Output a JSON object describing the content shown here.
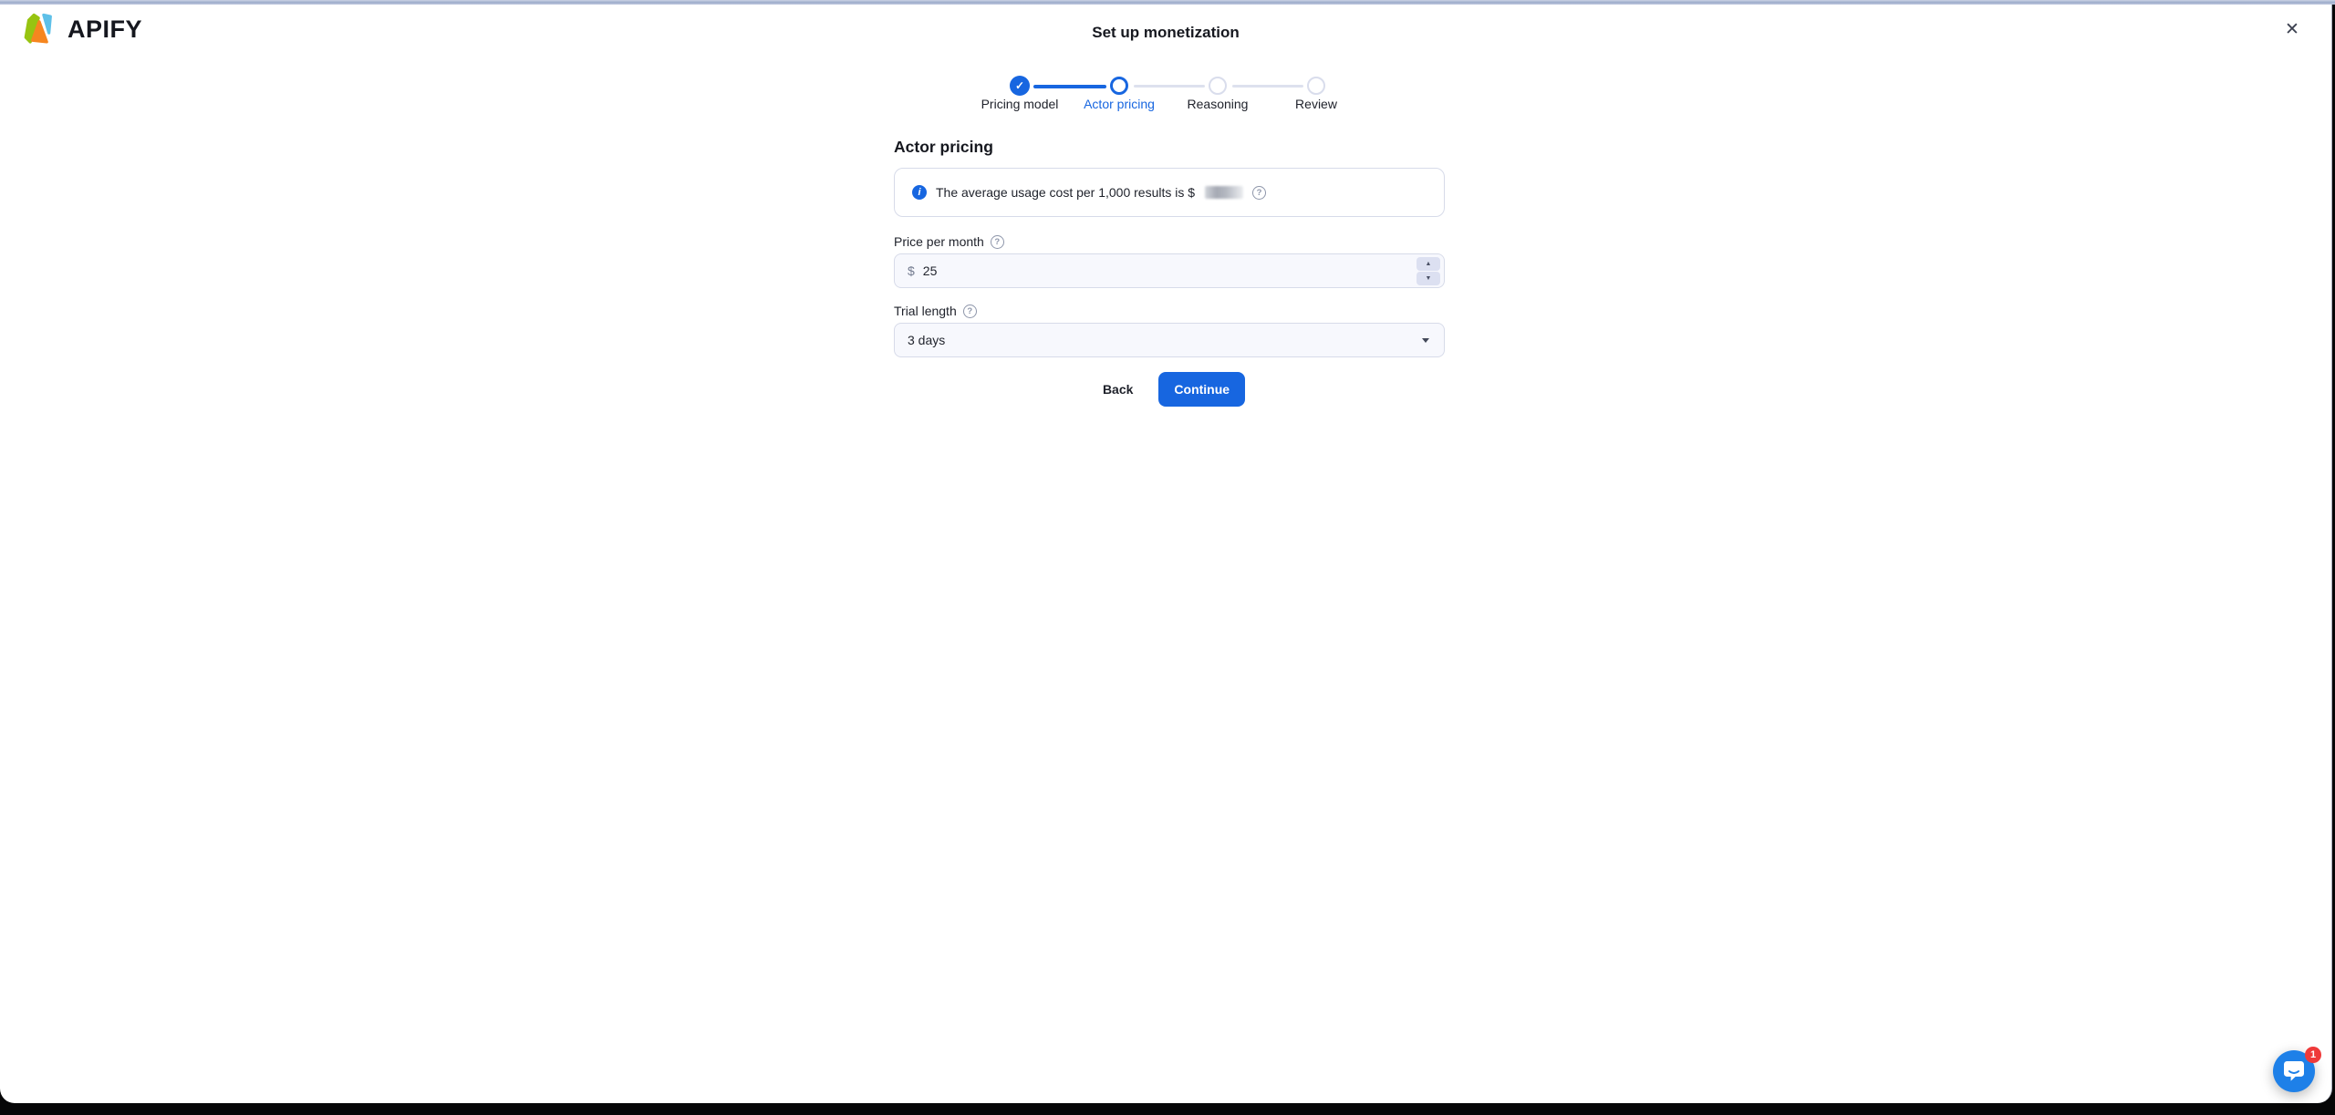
{
  "browser": {
    "close_glyph": "✕"
  },
  "brand": {
    "name": "APIFY"
  },
  "modal": {
    "title": "Set up monetization"
  },
  "stepper": {
    "steps": [
      {
        "label": "Pricing model",
        "state": "complete"
      },
      {
        "label": "Actor pricing",
        "state": "active"
      },
      {
        "label": "Reasoning",
        "state": "upcoming"
      },
      {
        "label": "Review",
        "state": "upcoming"
      }
    ]
  },
  "page": {
    "heading": "Actor pricing",
    "banner": {
      "text": "The average usage cost per 1,000 results is $",
      "value_state": "redacted"
    },
    "price_field": {
      "label": "Price per month",
      "currency_prefix": "$",
      "value": "25"
    },
    "trial_field": {
      "label": "Trial length",
      "selected_option": "3 days"
    },
    "actions": {
      "back": "Back",
      "continue": "Continue"
    }
  },
  "chat": {
    "unread_count": "1"
  },
  "icons": {
    "check": "✓",
    "info": "i",
    "help": "?",
    "spinner_up": "▲",
    "spinner_down": "▼"
  },
  "colors": {
    "accent_blue": "#1766e0",
    "stepper_inactive": "#d9ddec",
    "field_border": "#d7dbe9",
    "field_background": "#f7f8fd",
    "text_dark": "#1e212a",
    "text_muted": "#737b8f",
    "intercom_blue": "#1e80e8",
    "badge_red": "#ef3a3a",
    "logo_green": "#97c411",
    "logo_light_blue": "#5ec0e8",
    "logo_orange": "#f6861f",
    "top_edge": "#a9b5d2",
    "bottom_strip": "#060607"
  }
}
